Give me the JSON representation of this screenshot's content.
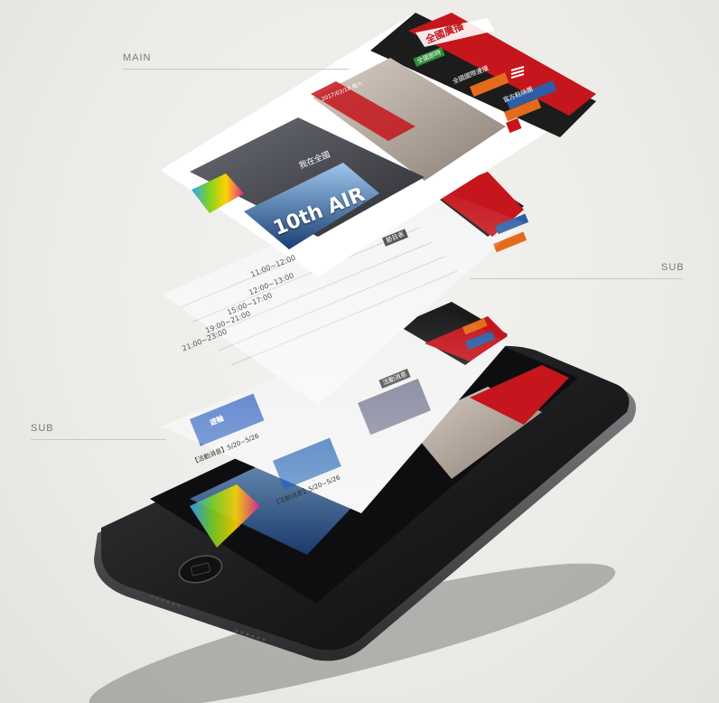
{
  "callouts": {
    "main": "MAIN",
    "sub_right": "SUB",
    "sub_left": "SUB"
  },
  "screens": {
    "main": {
      "logo": "全國廣播",
      "menu_1": "全國即時",
      "menu_2": "全國國際連播",
      "fb_button": "官方粉絲團",
      "hero_badge": "2017/03/18 周六",
      "banner_text": "10th AIR",
      "tagline": "我在全國"
    },
    "sub1": {
      "tab": "節目表",
      "schedule": [
        "11:00~12:00",
        "12:00~13:00",
        "15:00~17:00",
        "19:00~21:00",
        "21:00~23:00"
      ]
    },
    "sub2": {
      "tab": "活動消息",
      "news": [
        "【活動消息】5/20~5/26",
        "【活動消息】5/20~5/26"
      ],
      "ship_label": "遊輪"
    }
  },
  "colors": {
    "brand_red": "#c4161c",
    "dark": "#1c1c1c",
    "bg": "#ecebe7"
  }
}
